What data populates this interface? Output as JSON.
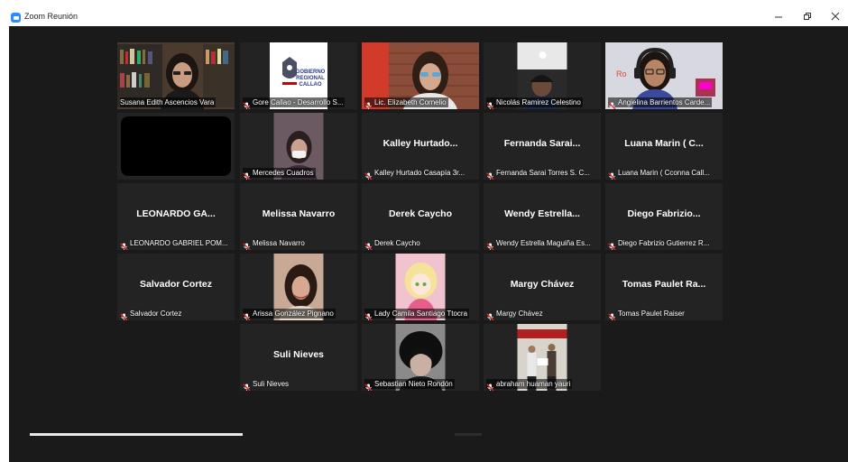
{
  "window": {
    "title": "Zoom Reunión",
    "minimize_icon": "minimize-icon",
    "restore_icon": "restore-icon",
    "close_icon": "close-icon"
  },
  "accent_color": "#d9ee69",
  "muted_color": "#e02828",
  "participants": [
    {
      "label": "Susana Edith Ascencios Vara",
      "muted": false,
      "active": true,
      "video": "bookshelf-woman"
    },
    {
      "label": "Gore Callao - Desarrollo S...",
      "muted": true,
      "video": "logo",
      "logo_lines": [
        "GOBIERNO",
        "REGIONAL",
        "CALLAO"
      ]
    },
    {
      "label": "Lic. Elizabeth Cornelio",
      "muted": true,
      "video": "brick-woman"
    },
    {
      "label": "Nicolás Ramirez Celestino",
      "muted": true,
      "video": "dark-kid"
    },
    {
      "label": "Angielina Barrientos Carde...",
      "muted": true,
      "video": "headphones-girl"
    },
    {
      "label": "",
      "muted": false,
      "video": "black"
    },
    {
      "label": "Mercedes Cuadros",
      "muted": true,
      "video": "masked-person"
    },
    {
      "name": "Kalley Hurtado...",
      "label": "Kalley Hurtado Casapía 3r...",
      "muted": true
    },
    {
      "name": "Fernanda Sarai...",
      "label": "Fernanda Sarai Torres S. C...",
      "muted": true
    },
    {
      "name": "Luana Marin ( C...",
      "label": "Luana Marin ( Cconna Call...",
      "muted": true
    },
    {
      "name": "LEONARDO GA...",
      "label": "LEONARDO GABRIEL POM...",
      "muted": true
    },
    {
      "name": "Melissa Navarro",
      "label": "Melissa Navarro",
      "muted": true
    },
    {
      "name": "Derek Caycho",
      "label": "Derek Caycho",
      "muted": true
    },
    {
      "name": "Wendy Estrella...",
      "label": "Wendy Estrella Maguiña Es...",
      "muted": true
    },
    {
      "name": "Diego Fabrizio...",
      "label": "Diego Fabrizio Gutierrez R...",
      "muted": true
    },
    {
      "name": "Salvador Cortez",
      "label": "Salvador Cortez",
      "muted": true
    },
    {
      "label": "Arissa González Pignano",
      "muted": true,
      "video": "selfie-girl"
    },
    {
      "label": "Lady Camila Santiago Ttocra",
      "muted": true,
      "video": "anime-pink"
    },
    {
      "name": "Margy Chávez",
      "label": "Margy Chávez",
      "muted": true
    },
    {
      "name": "Tomas Paulet Ra...",
      "label": "Tomas Paulet Raiser",
      "muted": true
    },
    {
      "name": "Suli Nieves",
      "label": "Suli Nieves",
      "muted": true
    },
    {
      "label": "Sebastian Nieto Rondón",
      "muted": true,
      "video": "dark-hair"
    },
    {
      "label": "abraham huaman yauri",
      "muted": true,
      "video": "ceremony"
    }
  ]
}
